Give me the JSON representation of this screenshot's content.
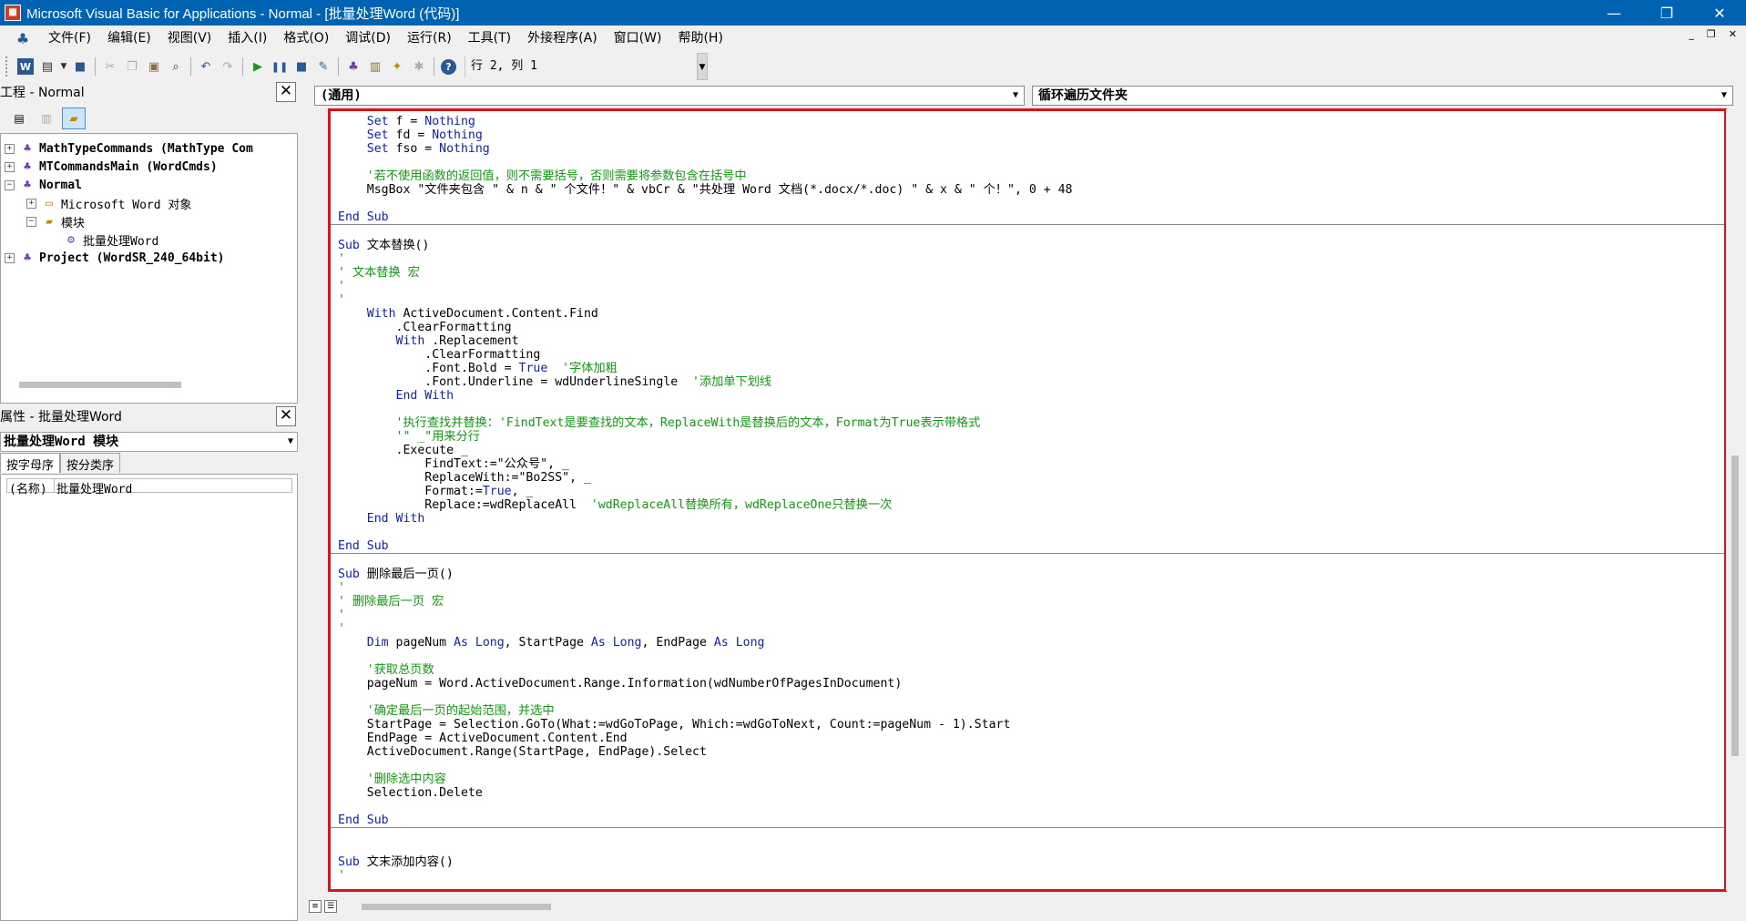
{
  "window": {
    "title": "Microsoft Visual Basic for Applications - Normal - [批量处理Word (代码)]",
    "minimize": "—",
    "restore": "❐",
    "close": "✕"
  },
  "menu": {
    "items": [
      "文件(F)",
      "编辑(E)",
      "视图(V)",
      "插入(I)",
      "格式(O)",
      "调试(D)",
      "运行(R)",
      "工具(T)",
      "外接程序(A)",
      "窗口(W)",
      "帮助(H)"
    ],
    "mdi_minimize": "_",
    "mdi_restore": "❐",
    "mdi_close": "✕"
  },
  "toolbar": {
    "position": "行 2, 列 1"
  },
  "project": {
    "header": "工程 - Normal",
    "tree": [
      {
        "label": "MathTypeCommands (MathType Com",
        "level": 0,
        "exp": "+",
        "bold": true,
        "icon": "vba-project-icon"
      },
      {
        "label": "MTCommandsMain (WordCmds)",
        "level": 0,
        "exp": "+",
        "bold": true,
        "icon": "vba-project-icon"
      },
      {
        "label": "Normal",
        "level": 0,
        "exp": "−",
        "bold": true,
        "icon": "vba-project-icon"
      },
      {
        "label": "Microsoft Word 对象",
        "level": 1,
        "exp": "+",
        "bold": false,
        "icon": "folder-icon"
      },
      {
        "label": "模块",
        "level": 1,
        "exp": "−",
        "bold": false,
        "icon": "folder-open-icon"
      },
      {
        "label": "批量处理Word",
        "level": 2,
        "exp": "",
        "bold": false,
        "icon": "module-icon"
      },
      {
        "label": "Project (WordSR_240_64bit)",
        "level": 0,
        "exp": "+",
        "bold": true,
        "icon": "vba-project-icon"
      }
    ]
  },
  "properties": {
    "header": "属性 - 批量处理Word",
    "selector": "批量处理Word 模块",
    "tabs": [
      "按字母序",
      "按分类序"
    ],
    "rows": [
      {
        "key": "(名称)",
        "value": "批量处理Word"
      }
    ]
  },
  "code_window": {
    "object_combo": "(通用)",
    "proc_combo": "循环遍历文件夹",
    "lines": [
      {
        "indent": 1,
        "parts": [
          {
            "t": "kw",
            "s": "Set"
          },
          {
            "t": "n",
            "s": " f = "
          },
          {
            "t": "kw",
            "s": "Nothing"
          }
        ]
      },
      {
        "indent": 1,
        "parts": [
          {
            "t": "kw",
            "s": "Set"
          },
          {
            "t": "n",
            "s": " fd = "
          },
          {
            "t": "kw",
            "s": "Nothing"
          }
        ]
      },
      {
        "indent": 1,
        "parts": [
          {
            "t": "kw",
            "s": "Set"
          },
          {
            "t": "n",
            "s": " fso = "
          },
          {
            "t": "kw",
            "s": "Nothing"
          }
        ]
      },
      {
        "indent": 0,
        "parts": []
      },
      {
        "indent": 1,
        "parts": [
          {
            "t": "cm",
            "s": "'若不使用函数的返回值，则不需要括号，否则需要将参数包含在括号中"
          }
        ]
      },
      {
        "indent": 1,
        "parts": [
          {
            "t": "n",
            "s": "MsgBox \"文件夹包含 \" & n & \" 个文件！\" & vbCr & \"共处理 Word 文档(*.docx/*.doc) \" & x & \" 个！\", 0 + 48"
          }
        ]
      },
      {
        "indent": 0,
        "parts": []
      },
      {
        "indent": 0,
        "parts": [
          {
            "t": "kw",
            "s": "End Sub"
          }
        ],
        "sep": true
      },
      {
        "indent": 0,
        "parts": []
      },
      {
        "indent": 0,
        "parts": [
          {
            "t": "kw",
            "s": "Sub"
          },
          {
            "t": "n",
            "s": " 文本替换()"
          }
        ]
      },
      {
        "indent": 0,
        "parts": [
          {
            "t": "cm",
            "s": "'"
          }
        ]
      },
      {
        "indent": 0,
        "parts": [
          {
            "t": "cm",
            "s": "' 文本替换 宏"
          }
        ]
      },
      {
        "indent": 0,
        "parts": [
          {
            "t": "cm",
            "s": "'"
          }
        ]
      },
      {
        "indent": 0,
        "parts": [
          {
            "t": "cm",
            "s": "'"
          }
        ]
      },
      {
        "indent": 1,
        "parts": [
          {
            "t": "kw",
            "s": "With"
          },
          {
            "t": "n",
            "s": " ActiveDocument.Content.Find"
          }
        ]
      },
      {
        "indent": 2,
        "parts": [
          {
            "t": "n",
            "s": ".ClearFormatting"
          }
        ]
      },
      {
        "indent": 2,
        "parts": [
          {
            "t": "kw",
            "s": "With"
          },
          {
            "t": "n",
            "s": " .Replacement"
          }
        ]
      },
      {
        "indent": 3,
        "parts": [
          {
            "t": "n",
            "s": ".ClearFormatting"
          }
        ]
      },
      {
        "indent": 3,
        "parts": [
          {
            "t": "n",
            "s": ".Font.Bold = "
          },
          {
            "t": "kw",
            "s": "True"
          },
          {
            "t": "n",
            "s": "  "
          },
          {
            "t": "cm",
            "s": "'字体加粗"
          }
        ]
      },
      {
        "indent": 3,
        "parts": [
          {
            "t": "n",
            "s": ".Font.Underline = wdUnderlineSingle  "
          },
          {
            "t": "cm",
            "s": "'添加单下划线"
          }
        ]
      },
      {
        "indent": 2,
        "parts": [
          {
            "t": "kw",
            "s": "End With"
          }
        ]
      },
      {
        "indent": 0,
        "parts": []
      },
      {
        "indent": 2,
        "parts": [
          {
            "t": "cm",
            "s": "'执行查找并替换：'FindText是要查找的文本，ReplaceWith是替换后的文本，Format为True表示带格式"
          }
        ]
      },
      {
        "indent": 2,
        "parts": [
          {
            "t": "cm",
            "s": "'\" _\"用来分行"
          }
        ]
      },
      {
        "indent": 2,
        "parts": [
          {
            "t": "n",
            "s": ".Execute _"
          }
        ]
      },
      {
        "indent": 3,
        "parts": [
          {
            "t": "n",
            "s": "FindText:=\"公众号\", _"
          }
        ]
      },
      {
        "indent": 3,
        "parts": [
          {
            "t": "n",
            "s": "ReplaceWith:=\"Bo2SS\", _"
          }
        ]
      },
      {
        "indent": 3,
        "parts": [
          {
            "t": "n",
            "s": "Format:="
          },
          {
            "t": "kw",
            "s": "True"
          },
          {
            "t": "n",
            "s": ", _"
          }
        ]
      },
      {
        "indent": 3,
        "parts": [
          {
            "t": "n",
            "s": "Replace:=wdReplaceAll  "
          },
          {
            "t": "cm",
            "s": "'wdReplaceAll替换所有，wdReplaceOne只替换一次"
          }
        ]
      },
      {
        "indent": 1,
        "parts": [
          {
            "t": "kw",
            "s": "End With"
          }
        ]
      },
      {
        "indent": 0,
        "parts": []
      },
      {
        "indent": 0,
        "parts": [
          {
            "t": "kw",
            "s": "End Sub"
          }
        ],
        "sep": true
      },
      {
        "indent": 0,
        "parts": []
      },
      {
        "indent": 0,
        "parts": [
          {
            "t": "kw",
            "s": "Sub"
          },
          {
            "t": "n",
            "s": " 删除最后一页()"
          }
        ]
      },
      {
        "indent": 0,
        "parts": [
          {
            "t": "cm",
            "s": "'"
          }
        ]
      },
      {
        "indent": 0,
        "parts": [
          {
            "t": "cm",
            "s": "' 删除最后一页 宏"
          }
        ]
      },
      {
        "indent": 0,
        "parts": [
          {
            "t": "cm",
            "s": "'"
          }
        ]
      },
      {
        "indent": 0,
        "parts": [
          {
            "t": "cm",
            "s": "'"
          }
        ]
      },
      {
        "indent": 1,
        "parts": [
          {
            "t": "kw",
            "s": "Dim"
          },
          {
            "t": "n",
            "s": " pageNum "
          },
          {
            "t": "kw",
            "s": "As Long"
          },
          {
            "t": "n",
            "s": ", StartPage "
          },
          {
            "t": "kw",
            "s": "As Long"
          },
          {
            "t": "n",
            "s": ", EndPage "
          },
          {
            "t": "kw",
            "s": "As Long"
          }
        ]
      },
      {
        "indent": 0,
        "parts": []
      },
      {
        "indent": 1,
        "parts": [
          {
            "t": "cm",
            "s": "'获取总页数"
          }
        ]
      },
      {
        "indent": 1,
        "parts": [
          {
            "t": "n",
            "s": "pageNum = Word.ActiveDocument.Range.Information(wdNumberOfPagesInDocument)"
          }
        ]
      },
      {
        "indent": 0,
        "parts": []
      },
      {
        "indent": 1,
        "parts": [
          {
            "t": "cm",
            "s": "'确定最后一页的起始范围，并选中"
          }
        ]
      },
      {
        "indent": 1,
        "parts": [
          {
            "t": "n",
            "s": "StartPage = Selection.GoTo(What:=wdGoToPage, Which:=wdGoToNext, Count:=pageNum - 1).Start"
          }
        ]
      },
      {
        "indent": 1,
        "parts": [
          {
            "t": "n",
            "s": "EndPage = ActiveDocument.Content.End"
          }
        ]
      },
      {
        "indent": 1,
        "parts": [
          {
            "t": "n",
            "s": "ActiveDocument.Range(StartPage, EndPage).Select"
          }
        ]
      },
      {
        "indent": 0,
        "parts": []
      },
      {
        "indent": 1,
        "parts": [
          {
            "t": "cm",
            "s": "'删除选中内容"
          }
        ]
      },
      {
        "indent": 1,
        "parts": [
          {
            "t": "n",
            "s": "Selection.Delete"
          }
        ]
      },
      {
        "indent": 0,
        "parts": []
      },
      {
        "indent": 0,
        "parts": [
          {
            "t": "kw",
            "s": "End Sub"
          }
        ],
        "sep": true
      },
      {
        "indent": 0,
        "parts": []
      },
      {
        "indent": 0,
        "parts": []
      },
      {
        "indent": 0,
        "parts": [
          {
            "t": "kw",
            "s": "Sub"
          },
          {
            "t": "n",
            "s": " 文末添加内容()"
          }
        ]
      },
      {
        "indent": 0,
        "parts": [
          {
            "t": "cm",
            "s": "'"
          }
        ]
      }
    ]
  },
  "colors": {
    "keyword": "#1122aa",
    "comment": "#119911",
    "highlight_border": "#e0101a",
    "titlebar": "#0063b1"
  }
}
